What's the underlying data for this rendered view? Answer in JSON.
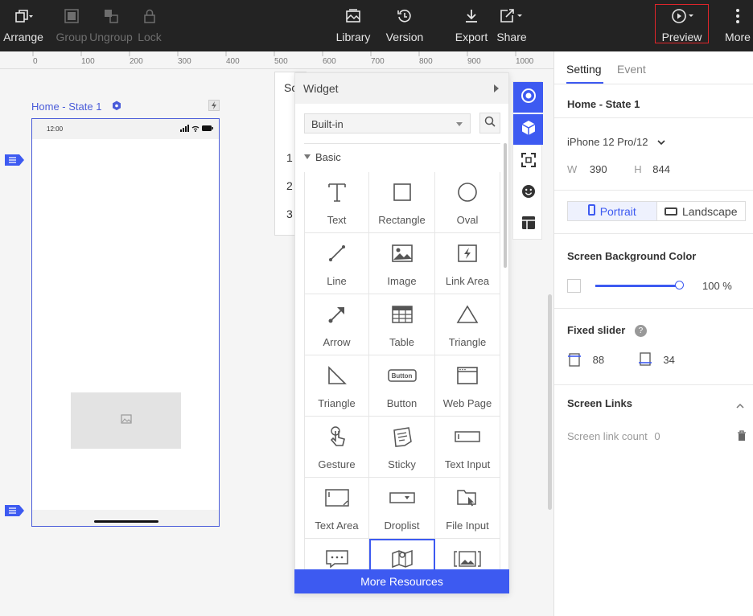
{
  "toolbar": {
    "left": [
      {
        "label": "Arrange",
        "icon": "arrange-icon",
        "disabled": false
      },
      {
        "label": "Group",
        "icon": "group-icon",
        "disabled": true
      },
      {
        "label": "Ungroup",
        "icon": "ungroup-icon",
        "disabled": true
      },
      {
        "label": "Lock",
        "icon": "lock-icon",
        "disabled": true
      }
    ],
    "center": [
      {
        "label": "Library",
        "icon": "library-icon"
      },
      {
        "label": "Version",
        "icon": "version-icon"
      },
      {
        "label": "Export",
        "icon": "export-icon"
      },
      {
        "label": "Share",
        "icon": "share-icon"
      }
    ],
    "right": [
      {
        "label": "Preview",
        "icon": "play-icon"
      },
      {
        "label": "More",
        "icon": "more-vertical-icon"
      }
    ]
  },
  "ruler": {
    "labels": [
      "0",
      "100",
      "200",
      "300",
      "400",
      "500",
      "600",
      "700",
      "800",
      "900",
      "1000"
    ]
  },
  "canvas": {
    "state_title": "Home - State 1",
    "phone_time": "12:00"
  },
  "behind_panel": {
    "title_partial": "Sc",
    "rows": [
      "1",
      "2",
      "3"
    ]
  },
  "widget_panel": {
    "title": "Widget",
    "library_select": "Built-in",
    "category": "Basic",
    "widgets": [
      {
        "label": "Text",
        "icon": "text-icon"
      },
      {
        "label": "Rectangle",
        "icon": "rectangle-icon"
      },
      {
        "label": "Oval",
        "icon": "oval-icon"
      },
      {
        "label": "Line",
        "icon": "line-icon"
      },
      {
        "label": "Image",
        "icon": "image-icon"
      },
      {
        "label": "Link Area",
        "icon": "link-area-icon"
      },
      {
        "label": "Arrow",
        "icon": "arrow-icon"
      },
      {
        "label": "Table",
        "icon": "table-icon"
      },
      {
        "label": "Triangle",
        "icon": "triangle-icon"
      },
      {
        "label": "Triangle",
        "icon": "right-triangle-icon"
      },
      {
        "label": "Button",
        "icon": "button-icon",
        "icon_text": "Button"
      },
      {
        "label": "Web Page",
        "icon": "web-page-icon"
      },
      {
        "label": "Gesture",
        "icon": "gesture-icon"
      },
      {
        "label": "Sticky",
        "icon": "sticky-icon"
      },
      {
        "label": "Text Input",
        "icon": "text-input-icon"
      },
      {
        "label": "Text Area",
        "icon": "text-area-icon"
      },
      {
        "label": "Droplist",
        "icon": "droplist-icon"
      },
      {
        "label": "File Input",
        "icon": "file-input-icon"
      },
      {
        "label": "",
        "icon": "comment-icon"
      },
      {
        "label": "",
        "icon": "map-icon"
      },
      {
        "label": "",
        "icon": "image-carousel-icon"
      }
    ],
    "more_resources": "More Resources"
  },
  "strip": {
    "icons": [
      "target-icon",
      "widget-cube-icon",
      "scan-icon",
      "emoji-icon",
      "layout-icon"
    ]
  },
  "right_panel": {
    "tabs": [
      "Setting",
      "Event"
    ],
    "state_name": "Home - State 1",
    "device": "iPhone 12 Pro/12",
    "w_label": "W",
    "w_value": "390",
    "h_label": "H",
    "h_value": "844",
    "portrait": "Portrait",
    "landscape": "Landscape",
    "bg_color_label": "Screen Background Color",
    "opacity": "100 %",
    "fixed_slider_label": "Fixed slider",
    "fixed_top": "88",
    "fixed_bottom": "34",
    "screen_links_label": "Screen Links",
    "link_count_label": "Screen link count",
    "link_count": "0"
  },
  "colors": {
    "accent": "#3d5af1",
    "toolbar_bg": "#232323",
    "highlight": "#e0252b"
  }
}
